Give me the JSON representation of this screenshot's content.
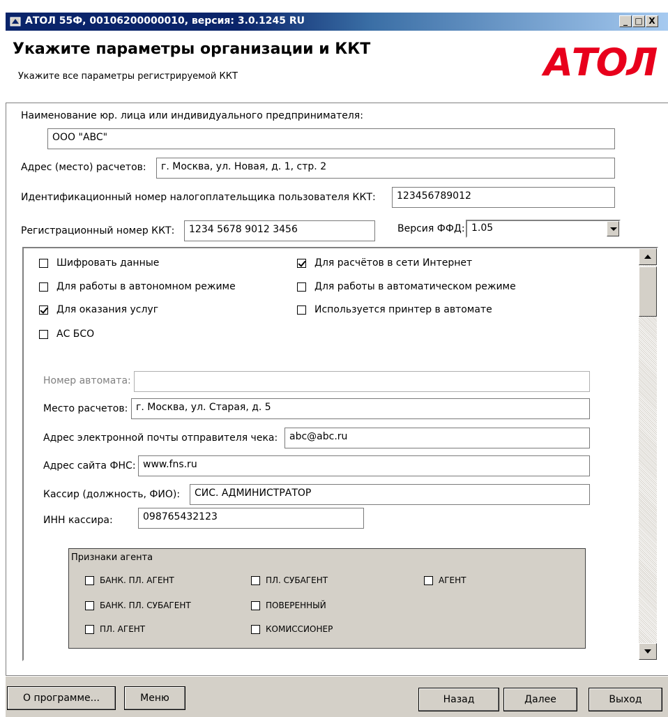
{
  "window": {
    "title": "АТОЛ 55Ф, 00106200000010, версия: 3.0.1245 RU",
    "controls": [
      "_",
      "□",
      "X"
    ]
  },
  "header": {
    "title": "Укажите параметры организации и ККТ",
    "subtitle": "Укажите все параметры регистрируемой ККТ",
    "logo": "АТОЛ"
  },
  "org": {
    "name_label": "Наименование юр. лица или индивидуального предпринимателя:",
    "name_value": "ООО \"ABC\"",
    "address_label": "Адрес (место) расчетов:",
    "address_value": "г. Москва, ул. Новая, д. 1, стр. 2",
    "inn_label": "Идентификационный номер налогоплательщика пользователя ККТ:",
    "inn_value": "123456789012",
    "regnum_label": "Регистрационный номер ККТ:",
    "regnum_value": "1234 5678 9012 3456",
    "ffd_label": "Версия ФФД:",
    "ffd_value": "1.05"
  },
  "flags": [
    {
      "label": "Шифровать данные",
      "checked": false
    },
    {
      "label": "Для расчётов в сети Интернет",
      "checked": true
    },
    {
      "label": "Для работы в автономном режиме",
      "checked": false
    },
    {
      "label": "Для работы в автоматическом режиме",
      "checked": false
    },
    {
      "label": "Для оказания услуг",
      "checked": true
    },
    {
      "label": "Используется принтер в автомате",
      "checked": false
    },
    {
      "label": "АС БСО",
      "checked": false
    }
  ],
  "details": {
    "automat_label": "Номер автомата:",
    "automat_value": "",
    "place_label": "Место расчетов:",
    "place_value": "г. Москва, ул. Старая, д. 5",
    "email_label": "Адрес электронной почты отправителя чека:",
    "email_value": "abc@abc.ru",
    "fns_label": "Адрес сайта ФНС:",
    "fns_value": "www.fns.ru",
    "cashier_label": "Кассир (должность, ФИО):",
    "cashier_value": "СИС. АДМИНИСТРАТОР",
    "cashier_inn_label": "ИНН кассира:",
    "cashier_inn_value": "098765432123"
  },
  "agent": {
    "title": "Признаки агента",
    "items": [
      {
        "label": "БАНК. ПЛ. АГЕНТ",
        "checked": false
      },
      {
        "label": "ПЛ. СУБАГЕНТ",
        "checked": false
      },
      {
        "label": "АГЕНТ",
        "checked": false
      },
      {
        "label": "БАНК. ПЛ. СУБАГЕНТ",
        "checked": false
      },
      {
        "label": "ПОВЕРЕННЫЙ",
        "checked": false
      },
      {
        "label": "ПЛ. АГЕНТ",
        "checked": false
      },
      {
        "label": "КОМИССИОНЕР",
        "checked": false
      }
    ]
  },
  "footer": {
    "about": "О программе...",
    "menu": "Меню",
    "back": "Назад",
    "next": "Далее",
    "exit": "Выход"
  },
  "colors": {
    "logo": "#e8001c",
    "titlebar": "#0a246a",
    "face": "#d4d0c8"
  }
}
